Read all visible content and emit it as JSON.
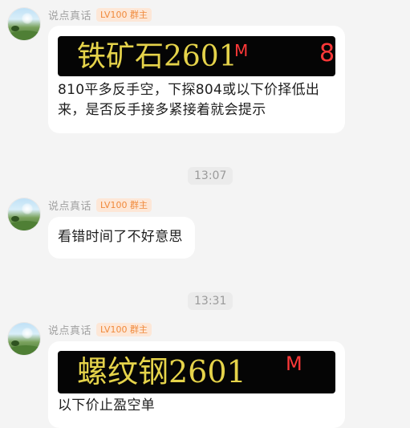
{
  "messages": [
    {
      "sender": "说点真话",
      "badge": "LV100 群主",
      "ticker": {
        "name": "铁矿石2601",
        "unit": "M",
        "extra": "8"
      },
      "text": "810平多反手空，下探804或以下价择低出\n来，是否反手接多紧接着就会提示"
    },
    {
      "sender": "说点真话",
      "badge": "LV100 群主",
      "text": "看错时间了不好意思"
    },
    {
      "sender": "说点真话",
      "badge": "LV100 群主",
      "ticker": {
        "name": "螺纹钢2601",
        "unit": "M"
      },
      "text": "以下价止盈空单"
    }
  ],
  "timestamps": [
    "13:07",
    "13:31"
  ],
  "colors": {
    "background": "#f4f4f4",
    "bubble": "#ffffff",
    "badge_text": "#f08a3c",
    "badge_bg": "#fde7d7",
    "ticker_bg": "#050505",
    "ticker_name": "#e5d34a",
    "ticker_accent": "#ff3838"
  },
  "icons": {
    "avatar": "landscape-avatar-icon"
  }
}
